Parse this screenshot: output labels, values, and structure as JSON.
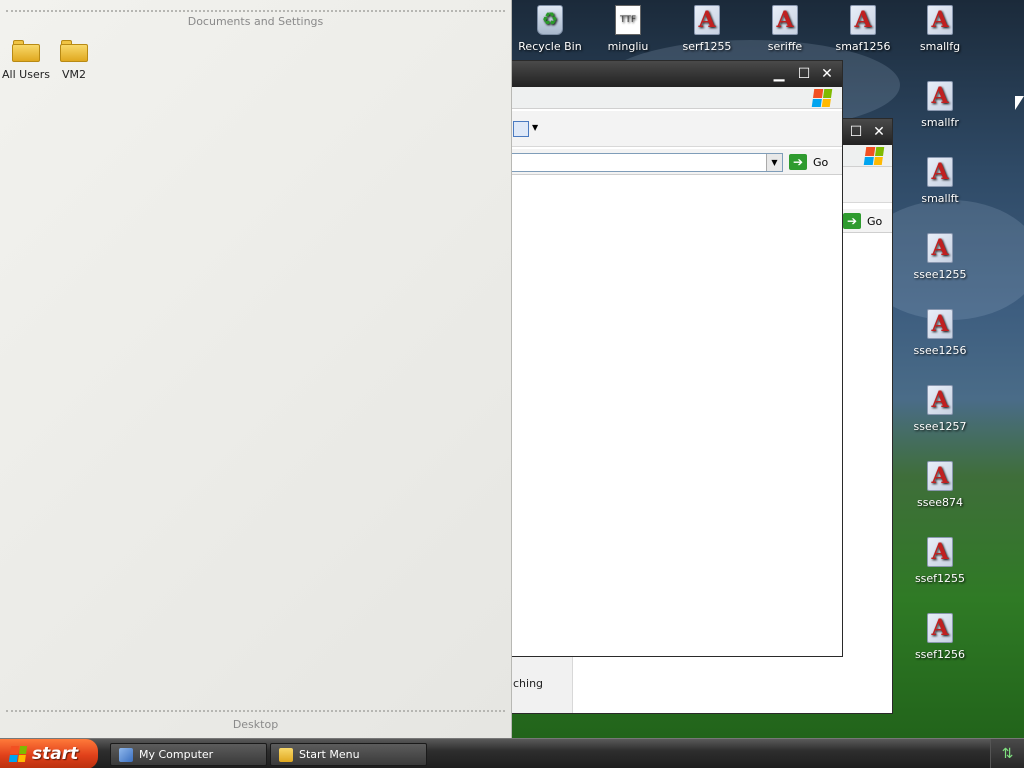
{
  "left_panel": {
    "header": "Documents and Settings",
    "items": [
      {
        "label": "All Users",
        "icon": "folder-icon"
      },
      {
        "label": "VM2",
        "icon": "folder-icon"
      }
    ],
    "footer": "Desktop"
  },
  "desktop_icons": [
    {
      "label": "Recycle Bin",
      "icon": "recycle-bin-icon"
    },
    {
      "label": "mingliu",
      "icon": "font-file-icon"
    },
    {
      "label": "serf1255",
      "icon": "font-file-icon"
    },
    {
      "label": "seriffe",
      "icon": "font-file-icon"
    },
    {
      "label": "smaf1256",
      "icon": "font-file-icon"
    },
    {
      "label": "smallfg",
      "icon": "font-file-icon"
    },
    {
      "label": "smallfr",
      "icon": "font-file-icon"
    },
    {
      "label": "smallft",
      "icon": "font-file-icon"
    },
    {
      "label": "ssee1255",
      "icon": "font-file-icon"
    },
    {
      "label": "ssee1256",
      "icon": "font-file-icon"
    },
    {
      "label": "ssee1257",
      "icon": "font-file-icon"
    },
    {
      "label": "ssee874",
      "icon": "font-file-icon"
    },
    {
      "label": "ssef1255",
      "icon": "font-file-icon"
    },
    {
      "label": "ssef1256",
      "icon": "font-file-icon"
    }
  ],
  "windows": {
    "front": {
      "go_label": "Go"
    },
    "back": {
      "go_label": "Go",
      "status_fragment": "ching"
    }
  },
  "taskbar": {
    "start_label": "start",
    "tasks": [
      {
        "label": "My Computer",
        "icon": "computer-icon"
      },
      {
        "label": "Start Menu",
        "icon": "folder-icon"
      }
    ]
  }
}
